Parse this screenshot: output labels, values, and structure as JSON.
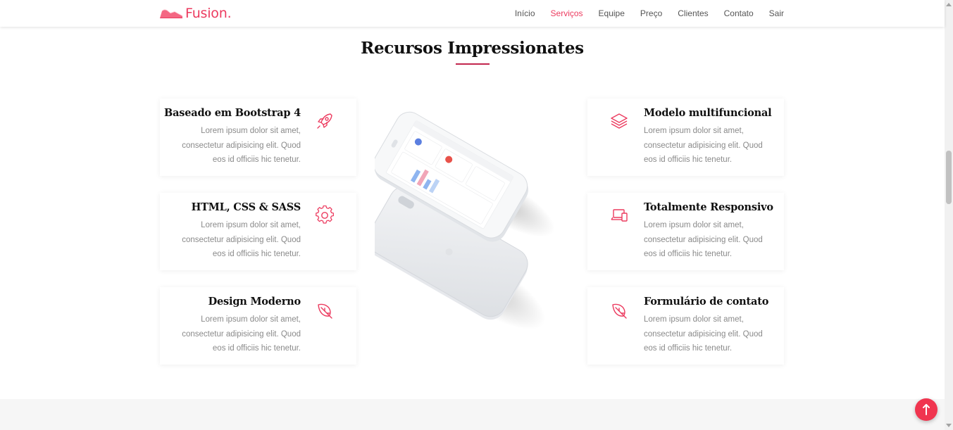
{
  "header": {
    "brand": "Fusion.",
    "nav": [
      {
        "label": "Início",
        "active": false
      },
      {
        "label": "Serviços",
        "active": true
      },
      {
        "label": "Equipe",
        "active": false
      },
      {
        "label": "Preço",
        "active": false
      },
      {
        "label": "Clientes",
        "active": false
      },
      {
        "label": "Contato",
        "active": false
      },
      {
        "label": "Sair",
        "active": false
      }
    ]
  },
  "section": {
    "title": "Recursos Impressionates"
  },
  "features": {
    "left": [
      {
        "title": "Baseado em Bootstrap 4",
        "icon": "rocket-icon",
        "lines": [
          "Lorem ipsum dolor sit amet,",
          "consectetur adipisicing elit. Quod",
          "eos id officiis hic tenetur."
        ]
      },
      {
        "title": "HTML, CSS & SASS",
        "icon": "gear-icon",
        "lines": [
          "Lorem ipsum dolor sit amet,",
          "consectetur adipisicing elit. Quod",
          "eos id officiis hic tenetur."
        ]
      },
      {
        "title": "Design Moderno",
        "icon": "leaf-icon",
        "lines": [
          "Lorem ipsum dolor sit amet,",
          "consectetur adipisicing elit. Quod",
          "eos id officiis hic tenetur."
        ]
      }
    ],
    "right": [
      {
        "title": "Modelo multifuncional",
        "icon": "layers-icon",
        "lines": [
          "Lorem ipsum dolor sit amet,",
          "consectetur adipisicing elit. Quod",
          "eos id officiis hic tenetur."
        ]
      },
      {
        "title": "Totalmente Responsivo",
        "icon": "devices-icon",
        "lines": [
          "Lorem ipsum dolor sit amet,",
          "consectetur adipisicing elit. Quod",
          "eos id officiis hic tenetur."
        ]
      },
      {
        "title": "Formulário de contato",
        "icon": "leaf-icon",
        "lines": [
          "Lorem ipsum dolor sit amet,",
          "consectetur adipisicing elit. Quod",
          "eos id officiis hic tenetur."
        ]
      }
    ]
  },
  "colors": {
    "accent": "#ec3b5f",
    "title_underline": "#c2264d",
    "back_to_top": "#f0354f"
  },
  "back_to_top_icon": "arrow-up-icon"
}
